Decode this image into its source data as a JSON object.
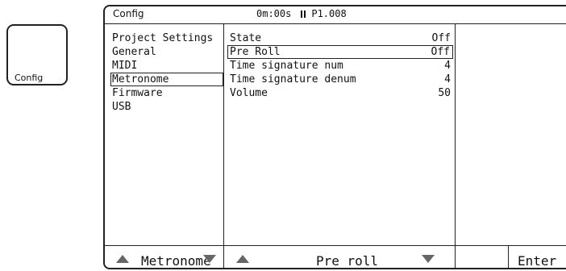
{
  "side_button": {
    "label": "Config"
  },
  "header": {
    "title": "Config",
    "time": "0m:00s",
    "position": "P1.008"
  },
  "menu": {
    "items": [
      {
        "label": "Project Settings"
      },
      {
        "label": "General"
      },
      {
        "label": "MIDI"
      },
      {
        "label": "Metronome",
        "selected": true
      },
      {
        "label": "Firmware"
      },
      {
        "label": "USB"
      }
    ]
  },
  "params": {
    "rows": [
      {
        "label": "State",
        "value": "Off"
      },
      {
        "label": "Pre Roll",
        "value": "Off",
        "selected": true
      },
      {
        "label": "Time signature num",
        "value": "4"
      },
      {
        "label": "Time signature denum",
        "value": "4"
      },
      {
        "label": "Volume",
        "value": "50"
      }
    ]
  },
  "footer": {
    "menu_label": "Metronome",
    "param_label": "Pre roll",
    "enter_label": "Enter"
  }
}
